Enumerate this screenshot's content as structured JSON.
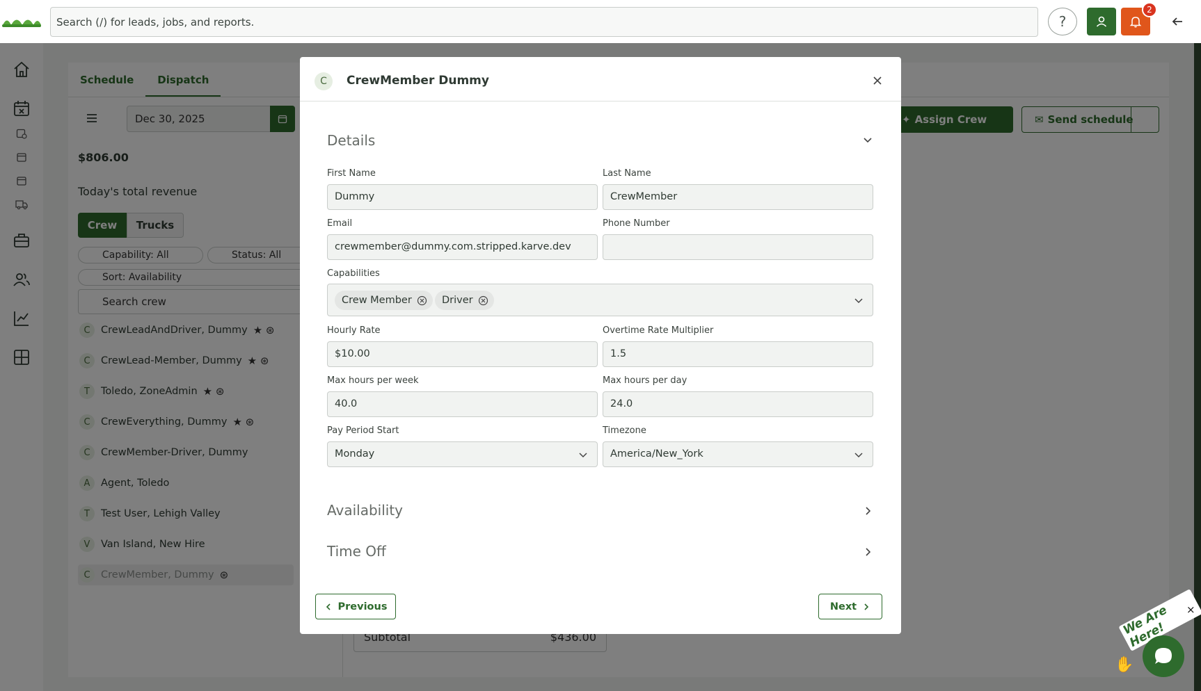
{
  "topbar": {
    "search_placeholder": "Search (/) for leads, jobs, and reports.",
    "help_label": "?",
    "notification_count": "2"
  },
  "sidebar": {
    "icons": [
      "home-icon",
      "calendar-icon",
      "calendar-time-icon",
      "calendar-small-icon",
      "calendar-small-icon",
      "truck-icon",
      "briefcase-icon",
      "people-icon",
      "chart-icon",
      "grid-icon"
    ]
  },
  "page": {
    "tabs": [
      "Schedule",
      "Dispatch"
    ],
    "active_tab": "Dispatch",
    "date": "Dec 30, 2025",
    "revenue": "$806.00",
    "revenue_label": "Today's total revenue",
    "toggle": [
      "Crew",
      "Trucks"
    ],
    "filters": {
      "capability": "Capability: All",
      "status": "Status: All",
      "sort": "Sort: Availability"
    },
    "crew_search_placeholder": "Search crew",
    "crew": [
      {
        "initial": "C",
        "name": "CrewLeadAndDriver, Dummy",
        "icons": "★ ⊛"
      },
      {
        "initial": "C",
        "name": "CrewLead-Member, Dummy",
        "icons": "★ ⊛"
      },
      {
        "initial": "T",
        "name": "Toledo, ZoneAdmin",
        "icons": "★ ⊛"
      },
      {
        "initial": "C",
        "name": "CrewEverything, Dummy",
        "icons": "★ ⊛"
      },
      {
        "initial": "C",
        "name": "CrewMember-Driver, Dummy",
        "icons": ""
      },
      {
        "initial": "A",
        "name": "Agent, Toledo",
        "icons": ""
      },
      {
        "initial": "T",
        "name": "Test User, Lehigh Valley",
        "icons": ""
      },
      {
        "initial": "V",
        "name": "Van Island, New Hire",
        "icons": ""
      },
      {
        "initial": "C",
        "name": "CrewMember, Dummy",
        "icons": "⊛"
      }
    ],
    "assign_crew": "Assign Crew",
    "send_schedule": "Send schedule",
    "subtotal_label": "Subtotal",
    "subtotal_value": "$436.00"
  },
  "modal": {
    "avatar": "C",
    "title": "CrewMember Dummy",
    "details_title": "Details",
    "fields": {
      "first_name_label": "First Name",
      "first_name": "Dummy",
      "last_name_label": "Last Name",
      "last_name": "CrewMember",
      "email_label": "Email",
      "email": "crewmember@dummy.com.stripped.karve.dev",
      "phone_label": "Phone Number",
      "phone": "",
      "capabilities_label": "Capabilities",
      "capabilities": [
        "Crew Member",
        "Driver"
      ],
      "hourly_rate_label": "Hourly Rate",
      "hourly_rate": "$10.00",
      "overtime_label": "Overtime Rate Multiplier",
      "overtime": "1.5",
      "max_week_label": "Max hours per week",
      "max_week": "40.0",
      "max_day_label": "Max hours per day",
      "max_day": "24.0",
      "pay_period_label": "Pay Period Start",
      "pay_period": "Monday",
      "timezone_label": "Timezone",
      "timezone": "America/New_York"
    },
    "availability_title": "Availability",
    "time_off_title": "Time Off",
    "previous": "Previous",
    "next": "Next"
  },
  "chat": {
    "tagline": "We Are Here!",
    "close": "×"
  },
  "colors": {
    "brand_green": "#2e6b2d",
    "alert_orange": "#e0561b"
  }
}
